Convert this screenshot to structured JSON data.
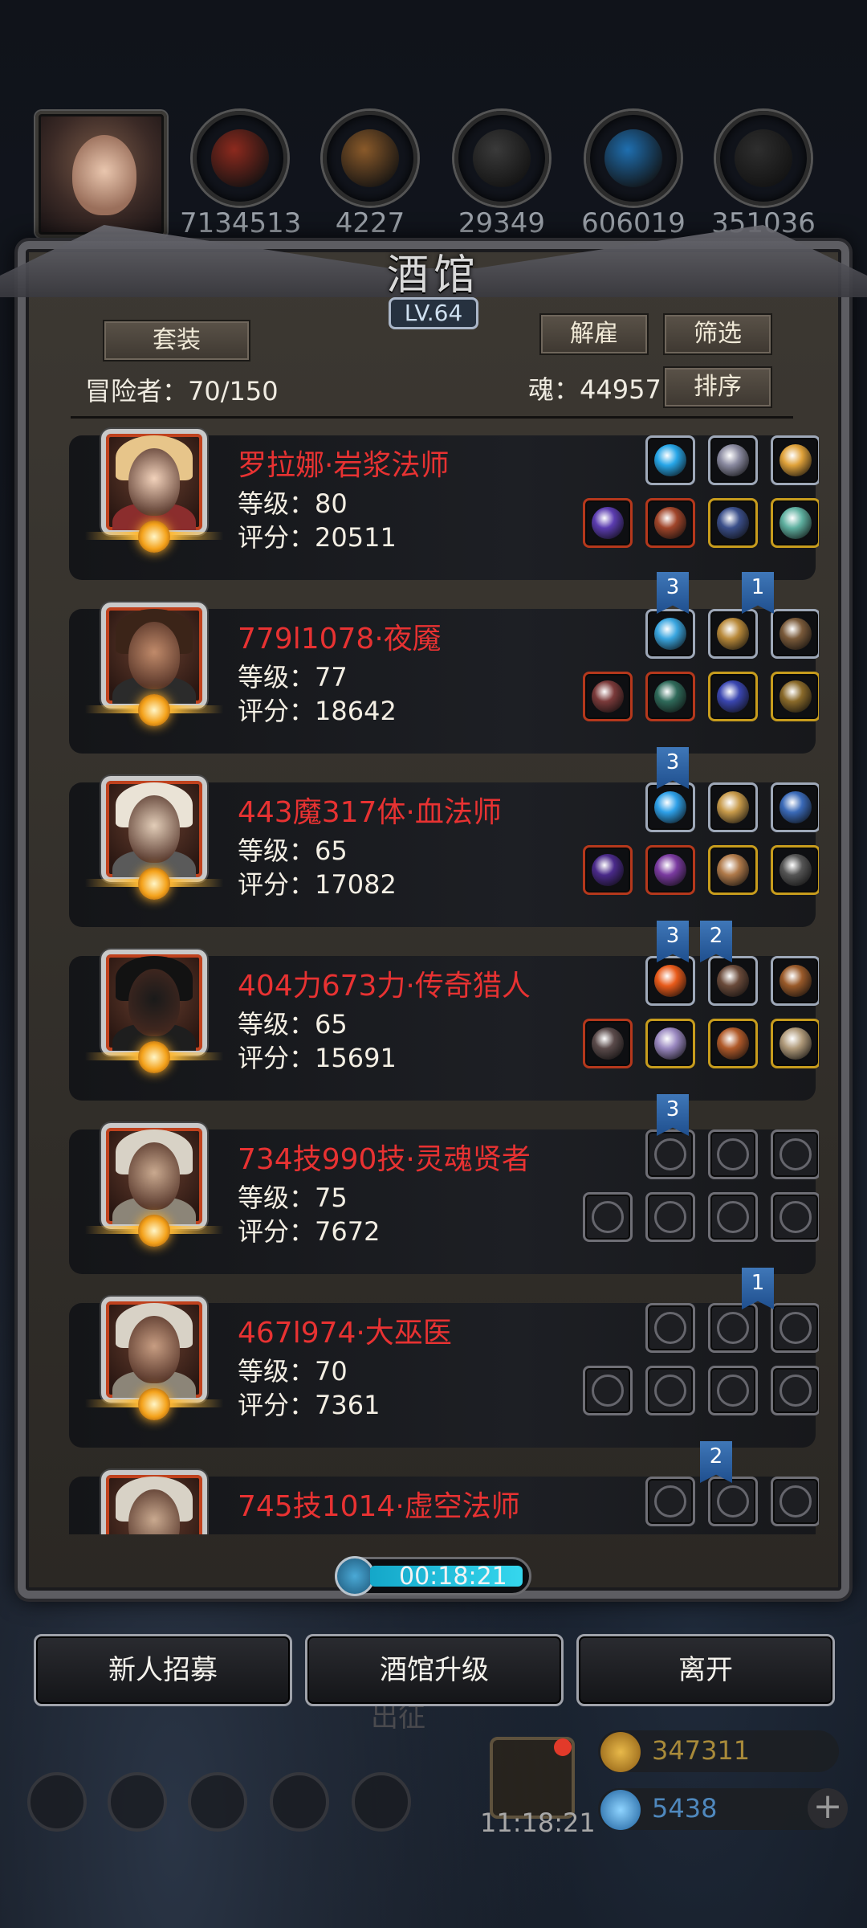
{
  "resources": [
    {
      "icon": "meat-icon",
      "value": "7134513",
      "color": "#8d2a1e"
    },
    {
      "icon": "wood-icon",
      "value": "4227",
      "color": "#8a5a2a"
    },
    {
      "icon": "stone-icon",
      "value": "29349",
      "color": "#3a3a3a"
    },
    {
      "icon": "crystal-icon",
      "value": "606019",
      "color": "#1f6fb0"
    },
    {
      "icon": "iron-icon",
      "value": "351036",
      "color": "#2e2e2e"
    }
  ],
  "panel": {
    "title": "酒馆",
    "level": "LV.64",
    "set_label": "套装",
    "dismiss_label": "解雇",
    "filter_label": "筛选",
    "sort_label": "排序",
    "adventurers": "冒险者：70/150",
    "soul": "魂：44957"
  },
  "heroes": [
    {
      "name": "罗拉娜·岩浆法师",
      "level": "等级：80",
      "score": "评分：20511"
    },
    {
      "name": "779l1078·夜魇",
      "level": "等级：77",
      "score": "评分：18642"
    },
    {
      "name": "443魔317体·血法师",
      "level": "等级：65",
      "score": "评分：17082"
    },
    {
      "name": "404力673力·传奇猎人",
      "level": "等级：65",
      "score": "评分：15691"
    },
    {
      "name": "734技990技·灵魂贤者",
      "level": "等级：75",
      "score": "评分：7672"
    },
    {
      "name": "467l974·大巫医",
      "level": "等级：70",
      "score": "评分：7361"
    },
    {
      "name": "745技1014·虚空法师",
      "level": "",
      "score": ""
    }
  ],
  "ribbons": [
    "3",
    "1",
    "3",
    "3",
    "2",
    "3",
    "1",
    "2"
  ],
  "timer": "00:18:21",
  "buttons": {
    "recruit": "新人招募",
    "upgrade": "酒馆升级",
    "leave": "离开"
  },
  "background": {
    "march": "出征",
    "gift_timer": "11:18:21",
    "gold": "347311",
    "gems": "5438"
  },
  "colors": {
    "hero_name": "#e83232",
    "ribbon": "#2f64a3",
    "accent_gold": "#f4a21b"
  }
}
